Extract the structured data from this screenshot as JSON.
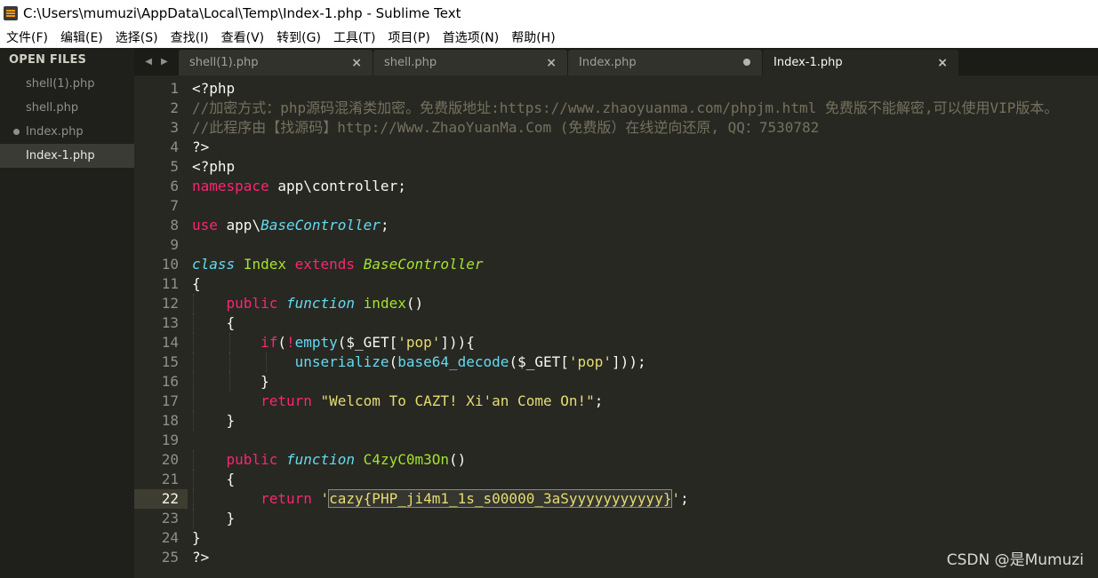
{
  "window": {
    "title": "C:\\Users\\mumuzi\\AppData\\Local\\Temp\\Index-1.php - Sublime Text"
  },
  "menu": [
    "文件(F)",
    "编辑(E)",
    "选择(S)",
    "查找(I)",
    "查看(V)",
    "转到(G)",
    "工具(T)",
    "项目(P)",
    "首选项(N)",
    "帮助(H)"
  ],
  "sidebar": {
    "header": "OPEN FILES",
    "files": [
      "shell(1).php",
      "shell.php",
      "Index.php",
      "Index-1.php"
    ]
  },
  "tabs": [
    {
      "label": "shell(1).php",
      "close": "×"
    },
    {
      "label": "shell.php",
      "close": "×"
    },
    {
      "label": "Index.php",
      "state": "modified"
    },
    {
      "label": "Index-1.php",
      "close": "×",
      "active": true
    }
  ],
  "tab_arrows": {
    "left": "◀",
    "right": "▶"
  },
  "editor": {
    "line_numbers": [
      "1",
      "2",
      "3",
      "4",
      "5",
      "6",
      "7",
      "8",
      "9",
      "10",
      "11",
      "12",
      "13",
      "14",
      "15",
      "16",
      "17",
      "18",
      "19",
      "20",
      "21",
      "22",
      "23",
      "24",
      "25"
    ],
    "current_line": 22,
    "lines": [
      [
        "<?php"
      ],
      [
        "//加密方式：php源码混淆类加密。免费版地址:https://www.zhaoyuanma.com/phpjm.html 免费版不能解密,可以使用VIP版本。"
      ],
      [
        "//此程序由【找源码】http://Www.ZhaoYuanMa.Com (免费版）在线逆向还原, QQ：7530782"
      ],
      [
        "?>"
      ],
      [
        "<?php"
      ],
      [
        "namespace",
        " app\\controller;"
      ],
      [
        ""
      ],
      [
        "use",
        " app\\",
        "BaseController",
        ";"
      ],
      [
        ""
      ],
      [
        "class",
        " ",
        "Index",
        " ",
        "extends",
        " ",
        "BaseController"
      ],
      [
        "{"
      ],
      [
        "    ",
        "public",
        " ",
        "function",
        " ",
        "index",
        "()"
      ],
      [
        "    {"
      ],
      [
        "        ",
        "if",
        "(",
        "!",
        "empty",
        "($_GET[",
        "'pop'",
        "])){"
      ],
      [
        "            ",
        "unserialize",
        "(",
        "base64_decode",
        "($_GET[",
        "'pop'",
        "]));"
      ],
      [
        "        }"
      ],
      [
        "        ",
        "return",
        " ",
        "\"Welcom To CAZT! Xi'an Come On!\"",
        ";"
      ],
      [
        "    }"
      ],
      [
        ""
      ],
      [
        "    ",
        "public",
        " ",
        "function",
        " ",
        "C4zyC0m3On",
        "()"
      ],
      [
        "    {"
      ],
      [
        "        ",
        "return",
        " ",
        "'",
        "cazy{PHP_ji4m1_1s_s00000_3aSyyyyyyyyyyy}",
        "'",
        ";"
      ],
      [
        "    }"
      ],
      [
        "}"
      ],
      [
        "?>"
      ]
    ]
  },
  "watermark": "CSDN @是Mumuzi"
}
